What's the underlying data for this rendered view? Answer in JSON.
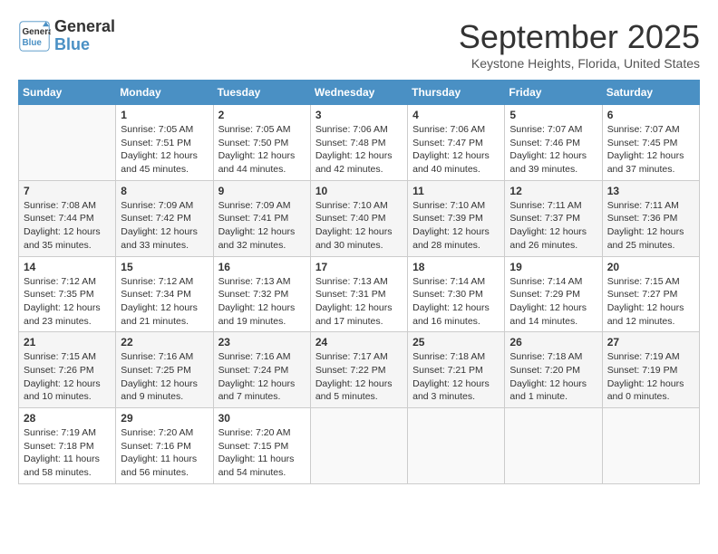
{
  "header": {
    "logo_line1": "General",
    "logo_line2": "Blue",
    "month": "September 2025",
    "location": "Keystone Heights, Florida, United States"
  },
  "weekdays": [
    "Sunday",
    "Monday",
    "Tuesday",
    "Wednesday",
    "Thursday",
    "Friday",
    "Saturday"
  ],
  "weeks": [
    [
      {
        "day": "",
        "info": ""
      },
      {
        "day": "1",
        "info": "Sunrise: 7:05 AM\nSunset: 7:51 PM\nDaylight: 12 hours\nand 45 minutes."
      },
      {
        "day": "2",
        "info": "Sunrise: 7:05 AM\nSunset: 7:50 PM\nDaylight: 12 hours\nand 44 minutes."
      },
      {
        "day": "3",
        "info": "Sunrise: 7:06 AM\nSunset: 7:48 PM\nDaylight: 12 hours\nand 42 minutes."
      },
      {
        "day": "4",
        "info": "Sunrise: 7:06 AM\nSunset: 7:47 PM\nDaylight: 12 hours\nand 40 minutes."
      },
      {
        "day": "5",
        "info": "Sunrise: 7:07 AM\nSunset: 7:46 PM\nDaylight: 12 hours\nand 39 minutes."
      },
      {
        "day": "6",
        "info": "Sunrise: 7:07 AM\nSunset: 7:45 PM\nDaylight: 12 hours\nand 37 minutes."
      }
    ],
    [
      {
        "day": "7",
        "info": "Sunrise: 7:08 AM\nSunset: 7:44 PM\nDaylight: 12 hours\nand 35 minutes."
      },
      {
        "day": "8",
        "info": "Sunrise: 7:09 AM\nSunset: 7:42 PM\nDaylight: 12 hours\nand 33 minutes."
      },
      {
        "day": "9",
        "info": "Sunrise: 7:09 AM\nSunset: 7:41 PM\nDaylight: 12 hours\nand 32 minutes."
      },
      {
        "day": "10",
        "info": "Sunrise: 7:10 AM\nSunset: 7:40 PM\nDaylight: 12 hours\nand 30 minutes."
      },
      {
        "day": "11",
        "info": "Sunrise: 7:10 AM\nSunset: 7:39 PM\nDaylight: 12 hours\nand 28 minutes."
      },
      {
        "day": "12",
        "info": "Sunrise: 7:11 AM\nSunset: 7:37 PM\nDaylight: 12 hours\nand 26 minutes."
      },
      {
        "day": "13",
        "info": "Sunrise: 7:11 AM\nSunset: 7:36 PM\nDaylight: 12 hours\nand 25 minutes."
      }
    ],
    [
      {
        "day": "14",
        "info": "Sunrise: 7:12 AM\nSunset: 7:35 PM\nDaylight: 12 hours\nand 23 minutes."
      },
      {
        "day": "15",
        "info": "Sunrise: 7:12 AM\nSunset: 7:34 PM\nDaylight: 12 hours\nand 21 minutes."
      },
      {
        "day": "16",
        "info": "Sunrise: 7:13 AM\nSunset: 7:32 PM\nDaylight: 12 hours\nand 19 minutes."
      },
      {
        "day": "17",
        "info": "Sunrise: 7:13 AM\nSunset: 7:31 PM\nDaylight: 12 hours\nand 17 minutes."
      },
      {
        "day": "18",
        "info": "Sunrise: 7:14 AM\nSunset: 7:30 PM\nDaylight: 12 hours\nand 16 minutes."
      },
      {
        "day": "19",
        "info": "Sunrise: 7:14 AM\nSunset: 7:29 PM\nDaylight: 12 hours\nand 14 minutes."
      },
      {
        "day": "20",
        "info": "Sunrise: 7:15 AM\nSunset: 7:27 PM\nDaylight: 12 hours\nand 12 minutes."
      }
    ],
    [
      {
        "day": "21",
        "info": "Sunrise: 7:15 AM\nSunset: 7:26 PM\nDaylight: 12 hours\nand 10 minutes."
      },
      {
        "day": "22",
        "info": "Sunrise: 7:16 AM\nSunset: 7:25 PM\nDaylight: 12 hours\nand 9 minutes."
      },
      {
        "day": "23",
        "info": "Sunrise: 7:16 AM\nSunset: 7:24 PM\nDaylight: 12 hours\nand 7 minutes."
      },
      {
        "day": "24",
        "info": "Sunrise: 7:17 AM\nSunset: 7:22 PM\nDaylight: 12 hours\nand 5 minutes."
      },
      {
        "day": "25",
        "info": "Sunrise: 7:18 AM\nSunset: 7:21 PM\nDaylight: 12 hours\nand 3 minutes."
      },
      {
        "day": "26",
        "info": "Sunrise: 7:18 AM\nSunset: 7:20 PM\nDaylight: 12 hours\nand 1 minute."
      },
      {
        "day": "27",
        "info": "Sunrise: 7:19 AM\nSunset: 7:19 PM\nDaylight: 12 hours\nand 0 minutes."
      }
    ],
    [
      {
        "day": "28",
        "info": "Sunrise: 7:19 AM\nSunset: 7:18 PM\nDaylight: 11 hours\nand 58 minutes."
      },
      {
        "day": "29",
        "info": "Sunrise: 7:20 AM\nSunset: 7:16 PM\nDaylight: 11 hours\nand 56 minutes."
      },
      {
        "day": "30",
        "info": "Sunrise: 7:20 AM\nSunset: 7:15 PM\nDaylight: 11 hours\nand 54 minutes."
      },
      {
        "day": "",
        "info": ""
      },
      {
        "day": "",
        "info": ""
      },
      {
        "day": "",
        "info": ""
      },
      {
        "day": "",
        "info": ""
      }
    ]
  ]
}
